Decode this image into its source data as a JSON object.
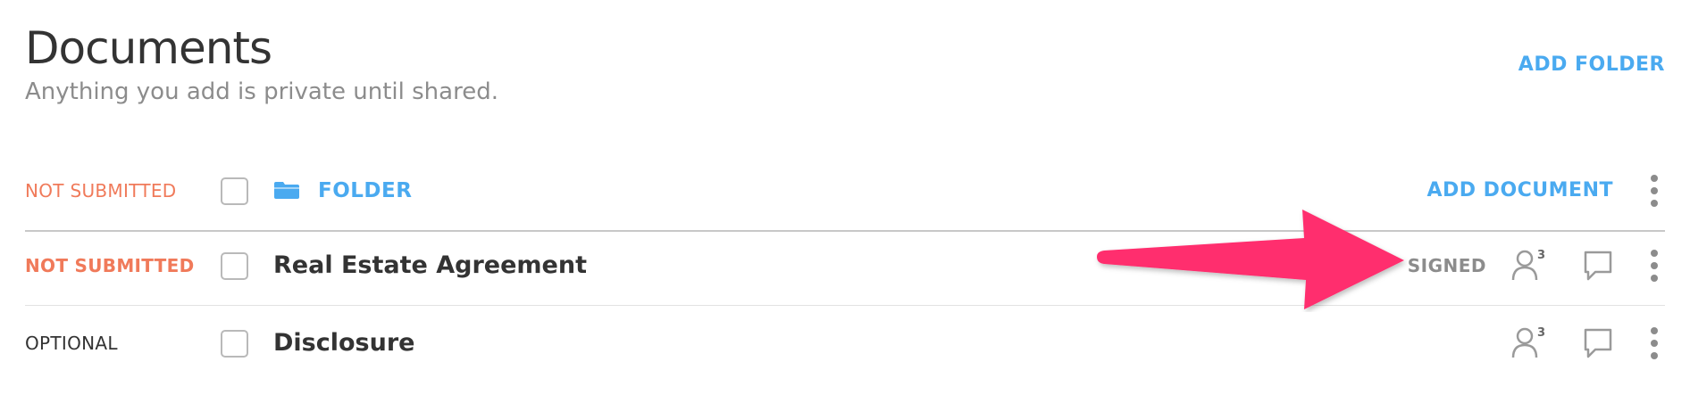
{
  "header": {
    "title": "Documents",
    "subtitle": "Anything you add is private until shared.",
    "add_folder_label": "ADD FOLDER"
  },
  "folder_row": {
    "status": "NOT SUBMITTED",
    "label": "FOLDER",
    "add_document_label": "ADD DOCUMENT"
  },
  "documents": [
    {
      "status": "NOT SUBMITTED",
      "name": "Real Estate Agreement",
      "signed_label": "SIGNED",
      "participants": "3"
    },
    {
      "status": "OPTIONAL",
      "name": "Disclosure",
      "participants": "3"
    }
  ],
  "colors": {
    "accent": "#4aaaf0",
    "status_warning": "#f07a5a",
    "annotation_arrow": "#ff2d6e"
  },
  "icons": [
    "folder-icon",
    "people-icon",
    "comment-icon",
    "kebab-menu-icon",
    "annotation-arrow"
  ]
}
